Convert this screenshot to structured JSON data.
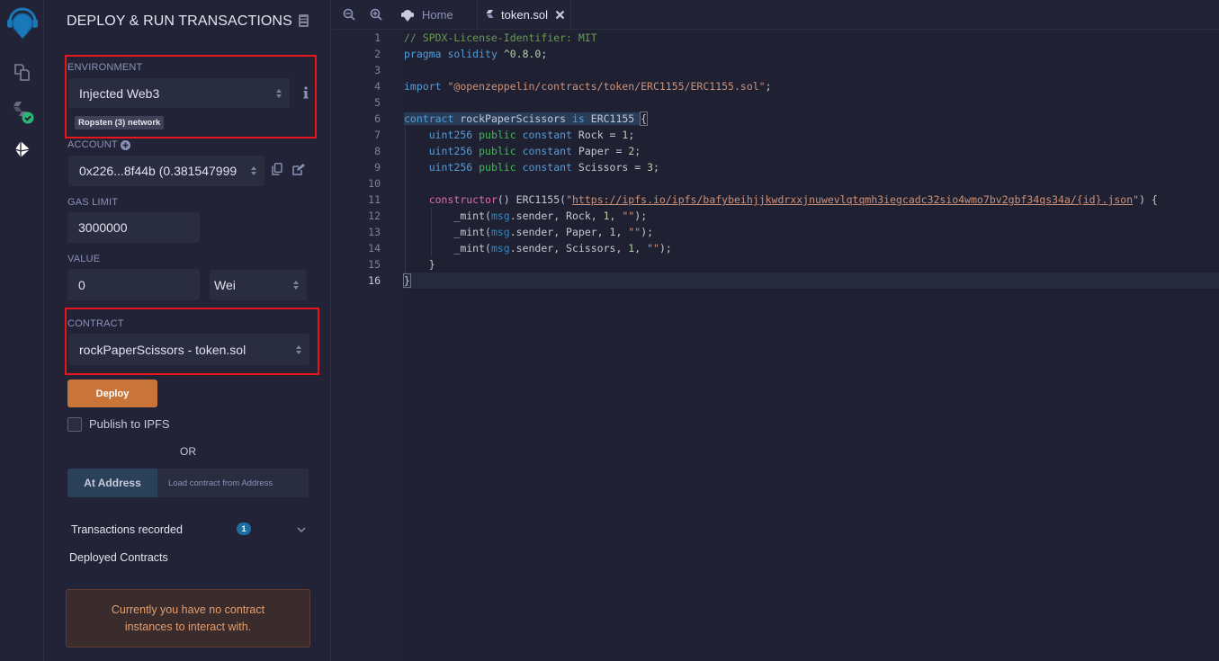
{
  "iconbar": {
    "items": [
      {
        "name": "remix-logo"
      },
      {
        "name": "file-explorer"
      },
      {
        "name": "solidity-compiler"
      },
      {
        "name": "deploy-run"
      }
    ]
  },
  "panel": {
    "title": "DEPLOY & RUN TRANSACTIONS",
    "environment": {
      "label": "ENVIRONMENT",
      "value": "Injected Web3",
      "network_badge": "Ropsten (3) network"
    },
    "account": {
      "label": "ACCOUNT",
      "value": "0x226...8f44b (0.381547999"
    },
    "gas_limit": {
      "label": "GAS LIMIT",
      "value": "3000000"
    },
    "value": {
      "label": "VALUE",
      "amount": "0",
      "unit": "Wei"
    },
    "contract": {
      "label": "CONTRACT",
      "value": "rockPaperScissors - token.sol"
    },
    "deploy_label": "Deploy",
    "publish_label": "Publish to IPFS",
    "publish_checked": false,
    "or_label": "OR",
    "at_address_label": "At Address",
    "at_address_placeholder": "Load contract from Address",
    "transactions_label": "Transactions recorded",
    "transactions_count": "1",
    "deployed_label": "Deployed Contracts",
    "no_instances_message": "Currently you have no contract instances to interact with."
  },
  "tabs": {
    "items": [
      {
        "label": "Home",
        "active": false
      },
      {
        "label": "token.sol",
        "active": true
      }
    ]
  },
  "editor": {
    "line_numbers": [
      "1",
      "2",
      "3",
      "4",
      "5",
      "6",
      "7",
      "8",
      "9",
      "10",
      "11",
      "12",
      "13",
      "14",
      "15",
      "16"
    ],
    "current_line": 16,
    "lines": [
      "// SPDX-License-Identifier: MIT",
      "pragma solidity ^0.8.0;",
      "",
      "import \"@openzeppelin/contracts/token/ERC1155/ERC1155.sol\";",
      "",
      "contract rockPaperScissors is ERC1155 {",
      "    uint256 public constant Rock = 1;",
      "    uint256 public constant Paper = 2;",
      "    uint256 public constant Scissors = 3;",
      "",
      "    constructor() ERC1155(\"https://ipfs.io/ipfs/bafybeihjjkwdrxxjnuwevlqtqmh3iegcadc32sio4wmo7bv2gbf34qs34a/{id}.json\") {",
      "        _mint(msg.sender, Rock, 1, \"\");",
      "        _mint(msg.sender, Paper, 1, \"\");",
      "        _mint(msg.sender, Scissors, 1, \"\");",
      "    }",
      "}"
    ],
    "tokens": {
      "comment": "// SPDX-License-Identifier: MIT",
      "pragma": "pragma",
      "solidity": "solidity",
      "version": "^0.8.0",
      "import": "import",
      "import_path": "\"@openzeppelin/contracts/token/ERC1155/ERC1155.sol\"",
      "contract_kw": "contract",
      "contract_name": "rockPaperScissors",
      "is_kw": "is",
      "base": "ERC1155",
      "uint": "uint256",
      "public": "public",
      "constant": "constant",
      "rock": "Rock",
      "paper": "Paper",
      "scissors": "Scissors",
      "one": "1",
      "two": "2",
      "three": "3",
      "constructor": "constructor",
      "url": "https://ipfs.io/ipfs/bafybeihjjkwdrxxjnuwevlqtqmh3iegcadc32sio4wmo7bv2gbf34qs34a/{id}.json",
      "mint": "_mint",
      "msg": "msg",
      "sender": ".sender, ",
      "empty_str": "\"\""
    }
  },
  "colors": {
    "accent_deploy": "#c97539",
    "highlight_red": "#e8151b",
    "badge_blue": "#1e6fa0",
    "at_address_bg": "#2a4159",
    "alert_text": "#e59e6c"
  }
}
